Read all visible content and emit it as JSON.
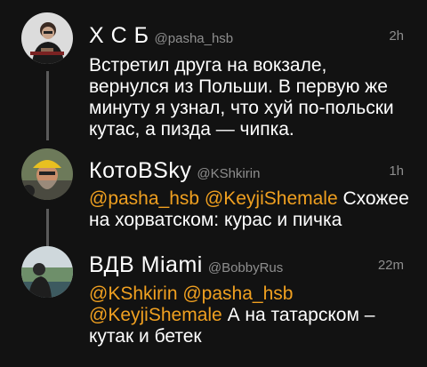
{
  "tweets": [
    {
      "name": "Х С Б",
      "handle": "@pasha_hsb",
      "time": "2h",
      "text_lines": [
        "Встретил друга на вокзале,",
        "вернулся из Польши. В первую же",
        "минуту я узнал, что хуй по-польски",
        "кутас, а пизда — чипка."
      ]
    },
    {
      "name": "КотоBSky",
      "handle": "@KShkirin",
      "time": "1h",
      "mentions": [
        "@pasha_hsb",
        "@KeyjiShemale"
      ],
      "text_line1": "Схожее",
      "text_line2": "на хорватском: курас и пичка"
    },
    {
      "name": "ВДВ Miami",
      "handle": "@BobbyRus",
      "time": "22m",
      "mentions": [
        "@KShkirin",
        "@pasha_hsb",
        "@KeyjiShemale"
      ],
      "text_line2": "А на татарском –",
      "text_line3": "кутак и бетек"
    }
  ],
  "colors": {
    "background": "#121212",
    "mention": "#f0a020",
    "secondary_text": "#8e8e8e",
    "thread_line": "#5a5a5a"
  }
}
